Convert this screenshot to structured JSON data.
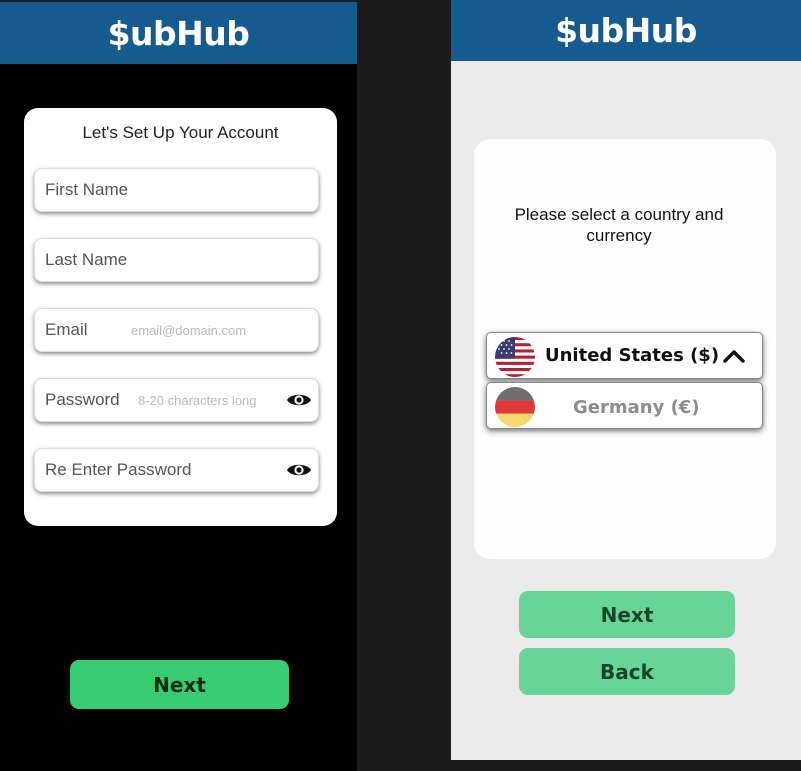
{
  "left_screen": {
    "app_title": "$ubHub",
    "form": {
      "title": "Let's Set Up Your Account",
      "first_name_label": "First Name",
      "last_name_label": "Last Name",
      "email_label": "Email",
      "email_placeholder": "email@domain.com",
      "password_label": "Password",
      "password_placeholder": "8-20 characters long",
      "reenter_password_label": "Re Enter Password"
    },
    "next_label": "Next"
  },
  "right_screen": {
    "app_title": "$ubHub",
    "prompt": "Please select a country and currency",
    "options": [
      {
        "label": "United States ($)",
        "flag": "us-flag-icon",
        "selected": true
      },
      {
        "label": "Germany (€)",
        "flag": "germany-flag-icon",
        "selected": false
      }
    ],
    "next_label": "Next",
    "back_label": "Back"
  },
  "colors": {
    "header": "#155b8e",
    "left_background": "#000000",
    "right_background": "#ebebeb",
    "next_button_left": "#37cc71",
    "buttons_right": "#68d596"
  }
}
